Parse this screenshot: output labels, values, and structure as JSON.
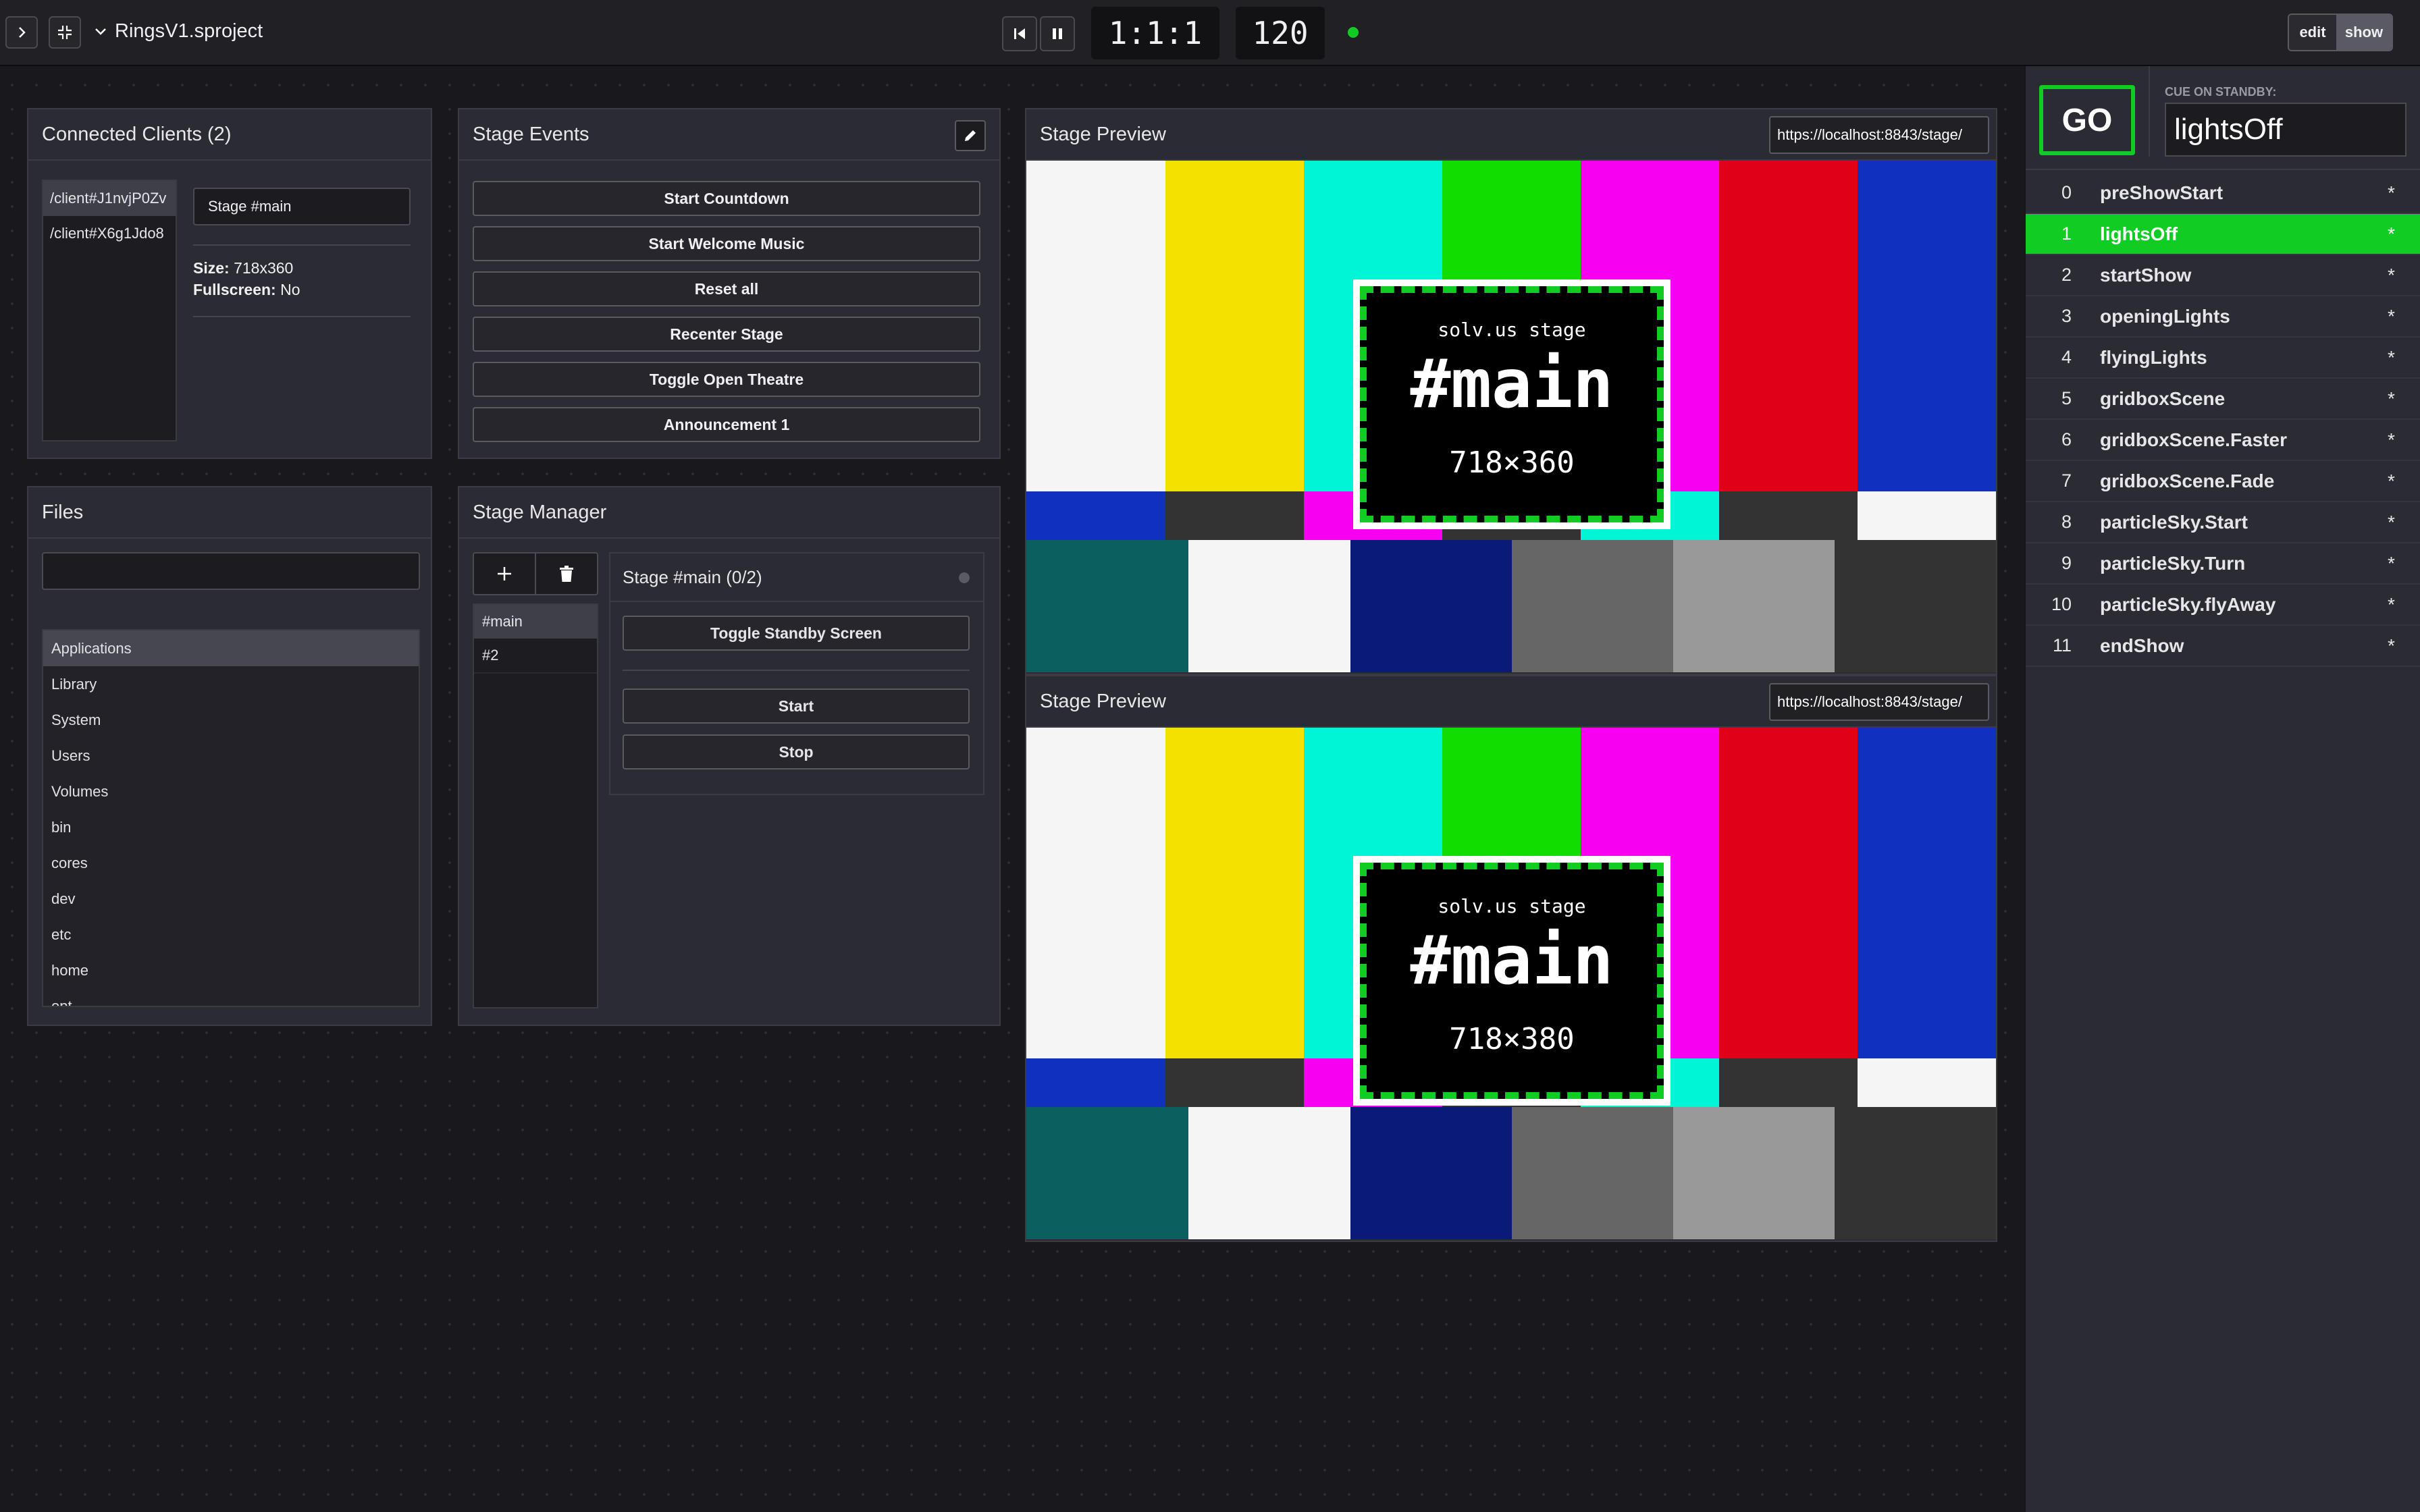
{
  "topbar": {
    "project_name": "RingsV1.sproject",
    "position": "1:1:1",
    "tempo": "120",
    "mode_edit": "edit",
    "mode_show": "show"
  },
  "clients": {
    "title": "Connected Clients (2)",
    "items": [
      "/client#J1nvjP0Zv",
      "/client#X6g1Jdo8"
    ],
    "stage_select": "Stage #main",
    "size_label": "Size:",
    "size_value": "718x360",
    "fullscreen_label": "Fullscreen:",
    "fullscreen_value": "No"
  },
  "events": {
    "title": "Stage Events",
    "buttons": [
      "Start Countdown",
      "Start Welcome Music",
      "Reset all",
      "Recenter Stage",
      "Toggle Open Theatre",
      "Announcement 1"
    ]
  },
  "files": {
    "title": "Files",
    "search_value": "",
    "items": [
      "Applications",
      "Library",
      "System",
      "Users",
      "Volumes",
      "bin",
      "cores",
      "dev",
      "etc",
      "home",
      "opt"
    ]
  },
  "manager": {
    "title": "Stage Manager",
    "stages": [
      "#main",
      "#2"
    ],
    "detail_title": "Stage #main (0/2)",
    "toggle_standby": "Toggle Standby Screen",
    "start": "Start",
    "stop": "Stop"
  },
  "previews": [
    {
      "title": "Stage Preview",
      "url": "https://localhost:8843/stage/",
      "sub": "solv.us stage",
      "stage": "#main",
      "size": "718×360"
    },
    {
      "title": "Stage Preview",
      "url": "https://localhost:8843/stage/",
      "sub": "solv.us stage",
      "stage": "#main",
      "size": "718×380"
    }
  ],
  "colors": {
    "accent_green": "#11cc22",
    "bars_top": [
      "#f5f5f5",
      "#f5e100",
      "#00f5d6",
      "#11dd00",
      "#f500f0",
      "#e00018",
      "#1030c0"
    ],
    "bars_mid": [
      "#1030c0",
      "#333333",
      "#f500f0",
      "#333333",
      "#00f5d6",
      "#333333",
      "#f5f5f5"
    ],
    "bars_bottom": [
      "#0b5f5f",
      "#f5f5f5",
      "#0a1a78",
      "#666666",
      "#999999",
      "#333333"
    ]
  },
  "cues": {
    "go_label": "GO",
    "standby_label": "CUE ON STANDBY:",
    "standby_value": "lightsOff",
    "active_index": 1,
    "list": [
      {
        "num": "0",
        "name": "preShowStart",
        "flag": "*"
      },
      {
        "num": "1",
        "name": "lightsOff",
        "flag": "*"
      },
      {
        "num": "2",
        "name": "startShow",
        "flag": "*"
      },
      {
        "num": "3",
        "name": "openingLights",
        "flag": "*"
      },
      {
        "num": "4",
        "name": "flyingLights",
        "flag": "*"
      },
      {
        "num": "5",
        "name": "gridboxScene",
        "flag": "*"
      },
      {
        "num": "6",
        "name": "gridboxScene.Faster",
        "flag": "*"
      },
      {
        "num": "7",
        "name": "gridboxScene.Fade",
        "flag": "*"
      },
      {
        "num": "8",
        "name": "particleSky.Start",
        "flag": "*"
      },
      {
        "num": "9",
        "name": "particleSky.Turn",
        "flag": "*"
      },
      {
        "num": "10",
        "name": "particleSky.flyAway",
        "flag": "*"
      },
      {
        "num": "11",
        "name": "endShow",
        "flag": "*"
      }
    ]
  }
}
